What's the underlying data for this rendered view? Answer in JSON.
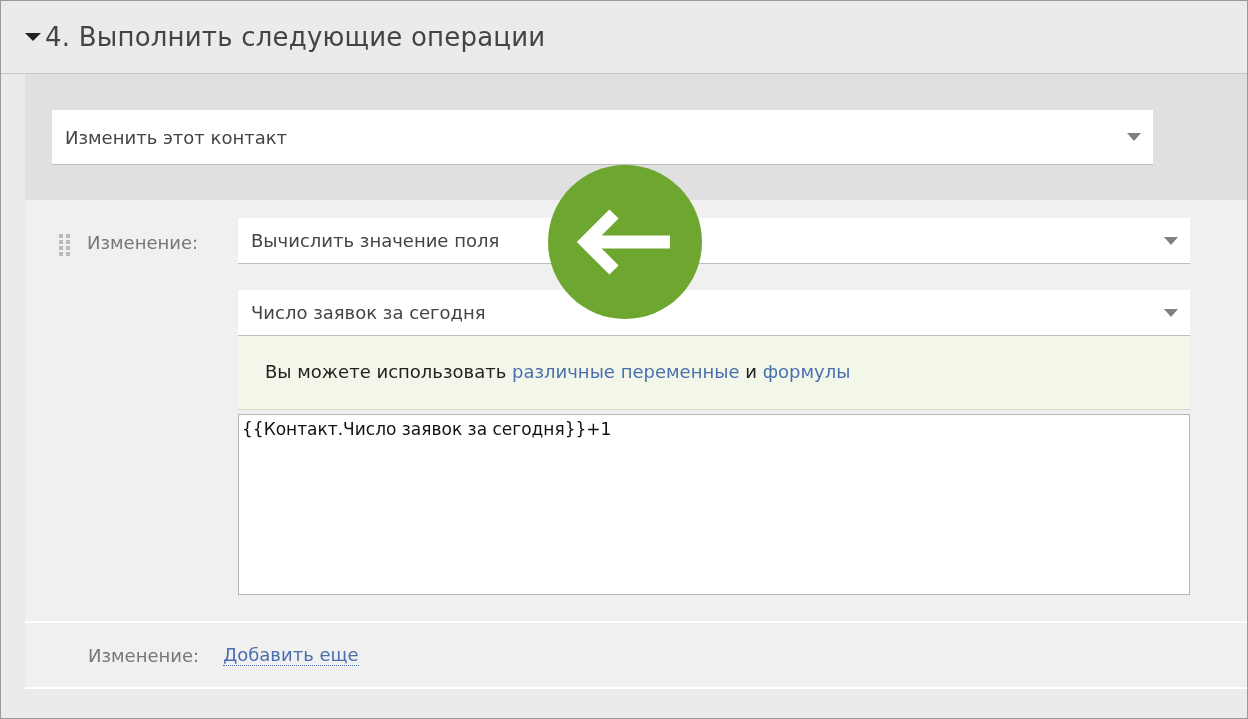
{
  "section": {
    "title": "4. Выполнить следующие операции",
    "expanded": true
  },
  "action_select": {
    "value": "Изменить этот контакт"
  },
  "change": {
    "label": "Изменение:",
    "type_select": {
      "value": "Вычислить значение поля"
    },
    "field_select": {
      "value": "Число заявок за сегодня"
    },
    "hint": [
      {
        "kind": "text",
        "text": "Вы можете использовать"
      },
      {
        "kind": "link",
        "text": "различные переменные"
      },
      {
        "kind": "text",
        "text": "и"
      },
      {
        "kind": "link",
        "text": "формулы"
      }
    ],
    "formula": {
      "value": "{{Контакт.Число заявок за сегодня}}+1"
    }
  },
  "footer": {
    "label": "Изменение:",
    "link": "Добавить еще"
  }
}
